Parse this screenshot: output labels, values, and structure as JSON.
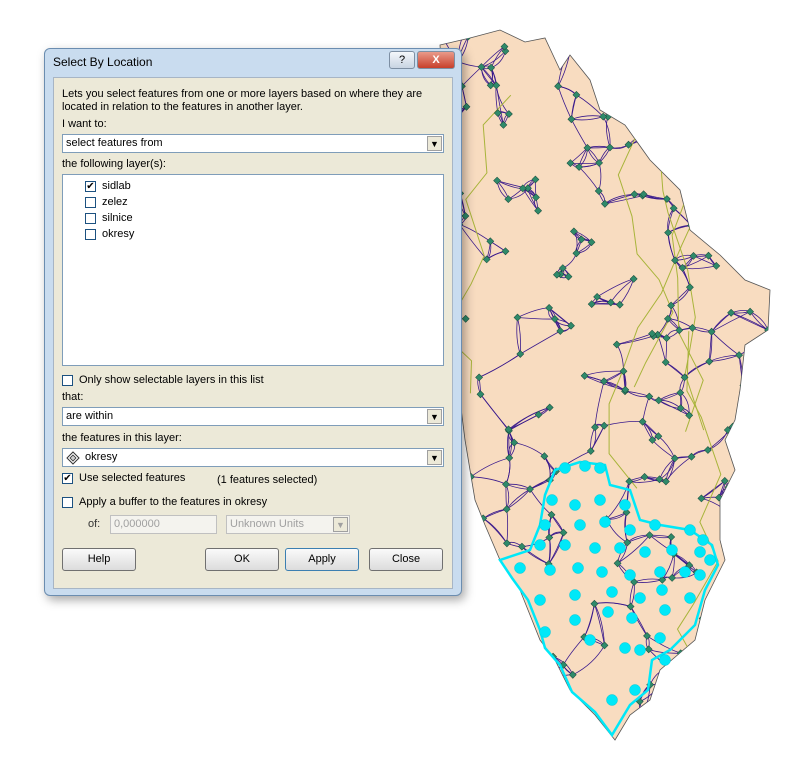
{
  "dialog": {
    "title": "Select By Location",
    "help_glyph": "?",
    "close_glyph": "X",
    "description_line1": "Lets you select features from one or more layers based on where they are",
    "description_line2": "located in relation to the features in another layer.",
    "i_want_to_label": "I want to:",
    "method_value": "select features from",
    "layers_label": "the following layer(s):",
    "layers": [
      {
        "name": "sidlab",
        "checked": true
      },
      {
        "name": "zelez",
        "checked": false
      },
      {
        "name": "silnice",
        "checked": false
      },
      {
        "name": "okresy",
        "checked": false
      }
    ],
    "only_selectable_label": "Only show selectable layers in this list",
    "that_label": "that:",
    "relation_value": "are within",
    "source_label": "the features in this layer:",
    "source_value": "okresy",
    "use_selected_label": "Use selected features",
    "selected_count_text": "(1 features selected)",
    "buffer_label": "Apply a buffer to the features in okresy",
    "of_label": "of:",
    "buffer_value": "0,000000",
    "units_value": "Unknown Units",
    "buttons": {
      "help": "Help",
      "ok": "OK",
      "apply": "Apply",
      "close": "Close"
    }
  },
  "colors": {
    "map_fill": "#f8dcc0",
    "roads": "#3a1a8c",
    "rail": "#a8b43a",
    "points": "#2f8a6a",
    "selection": "#00e8f8"
  },
  "checkmark": "✔",
  "arrow_glyph": "▼"
}
